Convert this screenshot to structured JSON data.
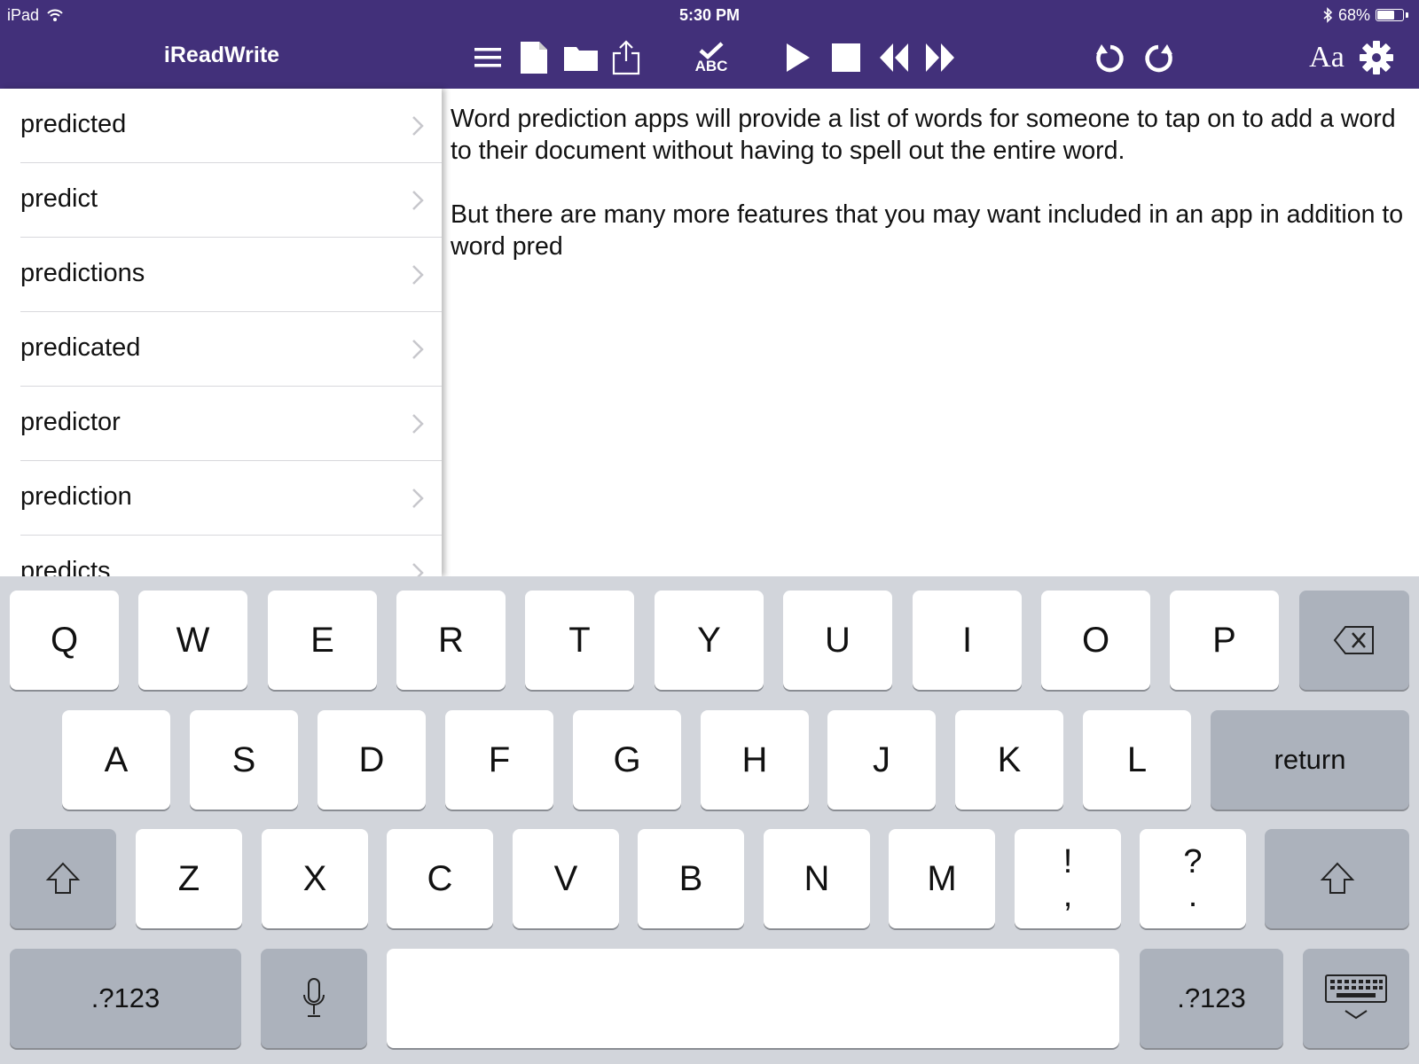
{
  "status_bar": {
    "device": "iPad",
    "time": "5:30 PM",
    "battery_percent": "68%",
    "battery_level": 0.68
  },
  "sidebar": {
    "title": "iReadWrite",
    "items": [
      {
        "label": "predicted"
      },
      {
        "label": "predict"
      },
      {
        "label": "predictions"
      },
      {
        "label": "predicated"
      },
      {
        "label": "predictor"
      },
      {
        "label": "prediction"
      },
      {
        "label": "predicts"
      }
    ]
  },
  "toolbar": {
    "icons": [
      "menu-icon",
      "new-document-icon",
      "folder-icon",
      "share-icon",
      "spell-check-icon",
      "play-icon",
      "stop-icon",
      "rewind-icon",
      "fast-forward-icon",
      "undo-icon",
      "redo-icon",
      "font-icon",
      "settings-icon"
    ],
    "spell_check_label": "ABC",
    "font_label": "Aa"
  },
  "document": {
    "text": "Word prediction apps will provide a list of words for someone to tap on to add a word to their document without having to spell out the entire word.\n\nBut there are many more features that you may want included in an app in addition to word pred"
  },
  "keyboard": {
    "row1": [
      "Q",
      "W",
      "E",
      "R",
      "T",
      "Y",
      "U",
      "I",
      "O",
      "P"
    ],
    "row2": [
      "A",
      "S",
      "D",
      "F",
      "G",
      "H",
      "J",
      "K",
      "L"
    ],
    "row3": [
      "Z",
      "X",
      "C",
      "V",
      "B",
      "N",
      "M"
    ],
    "punct1": {
      "top": "!",
      "bottom": ","
    },
    "punct2": {
      "top": "?",
      "bottom": "."
    },
    "return_label": "return",
    "numbers_label_left": ".?123",
    "numbers_label_right": ".?123"
  },
  "colors": {
    "header": "#42307a",
    "keyboard_bg": "#d2d5db",
    "func_key": "#acb2bc"
  }
}
